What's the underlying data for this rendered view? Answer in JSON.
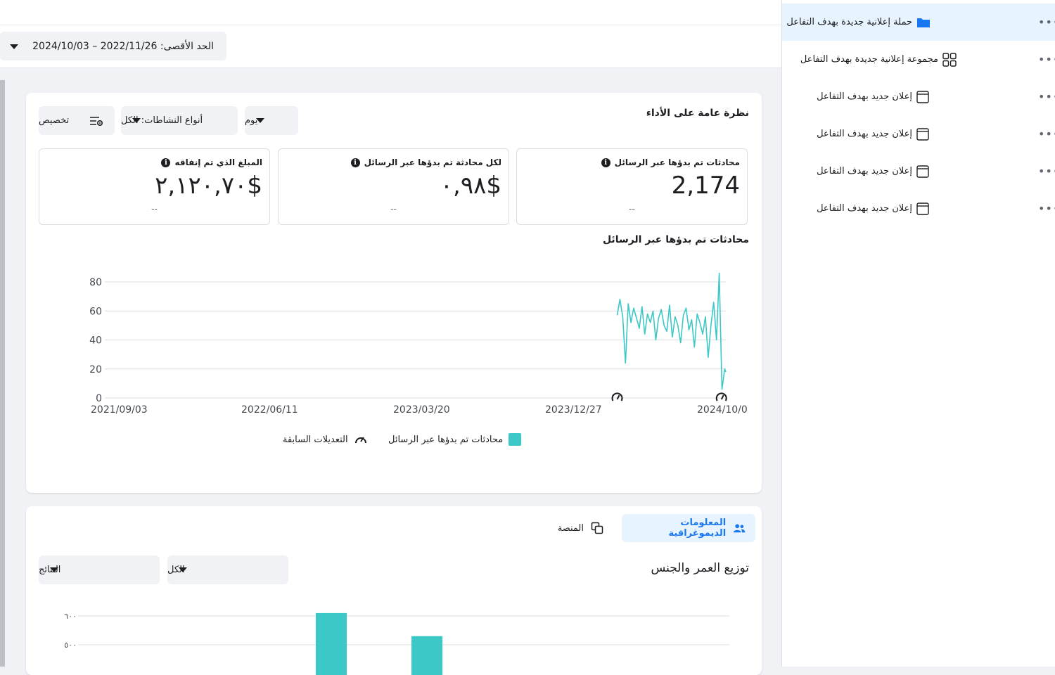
{
  "header": {
    "date_range": "الحد الأقصى: 2022/11/26 – 2024/10/03"
  },
  "overview": {
    "title": "نظرة عامة على الأداء",
    "customize_label": "تخصيص",
    "activity_types_label": "أنواع النشاطات: الكل",
    "granularity_label": "يوم",
    "metrics": [
      {
        "label": "محادثات تم بدؤها عبر الرسائل",
        "value": "2,174",
        "delta": "--"
      },
      {
        "label": "لكل محادثة تم بدؤها عبر الرسائل",
        "value": "٠,٩٨$",
        "delta": "--"
      },
      {
        "label": "المبلغ الذي تم إنفاقه",
        "value": "٢,١٢٠,٧٠$",
        "delta": "--"
      }
    ],
    "chart_title": "محادثات تم بدؤها عبر الرسائل",
    "legend_series": "محادثات تم بدؤها عبر الرسائل",
    "legend_edits": "التعديلات السابقة"
  },
  "chart_data": [
    {
      "type": "line",
      "title": "محادثات تم بدؤها عبر الرسائل",
      "x_ticks": [
        "2021/09/03",
        "2022/06/11",
        "2023/03/20",
        "2023/12/27",
        "2024/10/0"
      ],
      "y_ticks": [
        0,
        20,
        40,
        60,
        80
      ],
      "ylim": [
        0,
        80
      ],
      "grid": true,
      "legend": "bottom",
      "series": [
        {
          "name": "محادثات تم بدؤها عبر الرسائل",
          "color": "#3cc8c7",
          "x": [
            "2024/03/20",
            "2024/03/25",
            "2024/03/30",
            "2024/04/04",
            "2024/04/09",
            "2024/04/14",
            "2024/04/19",
            "2024/04/24",
            "2024/04/29",
            "2024/05/04",
            "2024/05/09",
            "2024/05/14",
            "2024/05/19",
            "2024/05/24",
            "2024/05/29",
            "2024/06/03",
            "2024/06/08",
            "2024/06/13",
            "2024/06/18",
            "2024/06/23",
            "2024/06/28",
            "2024/07/03",
            "2024/07/08",
            "2024/07/13",
            "2024/07/18",
            "2024/07/23",
            "2024/07/28",
            "2024/08/02",
            "2024/08/07",
            "2024/08/12",
            "2024/08/17",
            "2024/08/22",
            "2024/08/27",
            "2024/09/01",
            "2024/09/06",
            "2024/09/11",
            "2024/09/16",
            "2024/09/21",
            "2024/09/26",
            "2024/10/01",
            "2024/10/03"
          ],
          "y": [
            57,
            68,
            56,
            24,
            65,
            52,
            62,
            55,
            48,
            63,
            44,
            58,
            52,
            60,
            40,
            55,
            61,
            50,
            46,
            64,
            42,
            56,
            50,
            38,
            57,
            62,
            47,
            54,
            35,
            58,
            52,
            44,
            56,
            28,
            50,
            66,
            40,
            86,
            6,
            20,
            18
          ]
        }
      ],
      "annotations": [
        {
          "type": "previous-edit",
          "x": "2024/03/20"
        },
        {
          "type": "previous-edit",
          "x": "2024/09/25"
        }
      ]
    },
    {
      "type": "bar",
      "title": "توزيع العمر والجنس",
      "y_ticks": [
        "٦٠٠",
        "٥٠٠"
      ],
      "ylim_visible": [
        500,
        600
      ],
      "values": [
        610,
        530
      ],
      "color": "#3cc8c7"
    }
  ],
  "demographics": {
    "tab_demographics": "المعلومات الديموغرافية",
    "tab_platform": "المنصة",
    "title": "توزيع العمر والجنس",
    "filter_all": "الكل",
    "filter_results": "النتائج"
  },
  "sidebar": {
    "campaign": "حملة إعلانية جديدة بهدف التفاعل",
    "adset": "مجموعة إعلانية جديدة بهدف التفاعل",
    "ads": [
      "إعلان جديد بهدف التفاعل",
      "إعلان جديد بهدف التفاعل",
      "إعلان جديد بهدف التفاعل",
      "إعلان جديد بهدف التفاعل"
    ],
    "more": "•••",
    "accent": "#1877f2"
  }
}
